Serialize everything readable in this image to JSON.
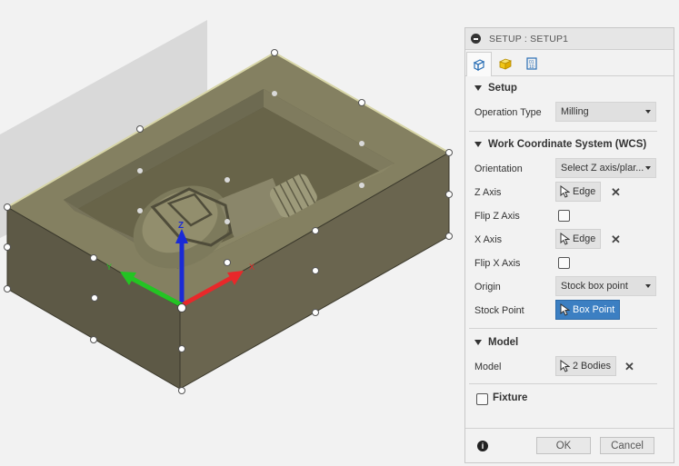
{
  "panel": {
    "title": "SETUP : SETUP1",
    "tabs": [
      {
        "icon": "setup-tab-icon",
        "active": true
      },
      {
        "icon": "stock-tab-icon",
        "active": false
      },
      {
        "icon": "post-process-tab-icon",
        "active": false
      }
    ],
    "setup_section": {
      "heading": "Setup",
      "operation_type_label": "Operation Type",
      "operation_type_value": "Milling"
    },
    "wcs_section": {
      "heading": "Work Coordinate System (WCS)",
      "orientation_label": "Orientation",
      "orientation_value": "Select Z axis/plar...",
      "z_axis_label": "Z Axis",
      "z_axis_value": "Edge",
      "flip_z_label": "Flip Z Axis",
      "x_axis_label": "X Axis",
      "x_axis_value": "Edge",
      "flip_x_label": "Flip X Axis",
      "origin_label": "Origin",
      "origin_value": "Stock box point",
      "stock_point_label": "Stock Point",
      "stock_point_value": "Box Point"
    },
    "model_section": {
      "heading": "Model",
      "model_label": "Model",
      "model_value": "2 Bodies"
    },
    "fixture_section": {
      "heading": "Fixture"
    },
    "ok_label": "OK",
    "cancel_label": "Cancel",
    "info_glyph": "i",
    "clear_glyph": "✕"
  },
  "viewport": {
    "axis_labels": {
      "z": "Z",
      "x": "X",
      "y": "Y"
    },
    "colors": {
      "stock_side": "#5f5a47",
      "stock_top": "#8b8764",
      "x_axis": "#e8282a",
      "y_axis": "#23c423",
      "z_axis": "#1a2ad6",
      "accent_blue": "#3c7fc2"
    }
  }
}
